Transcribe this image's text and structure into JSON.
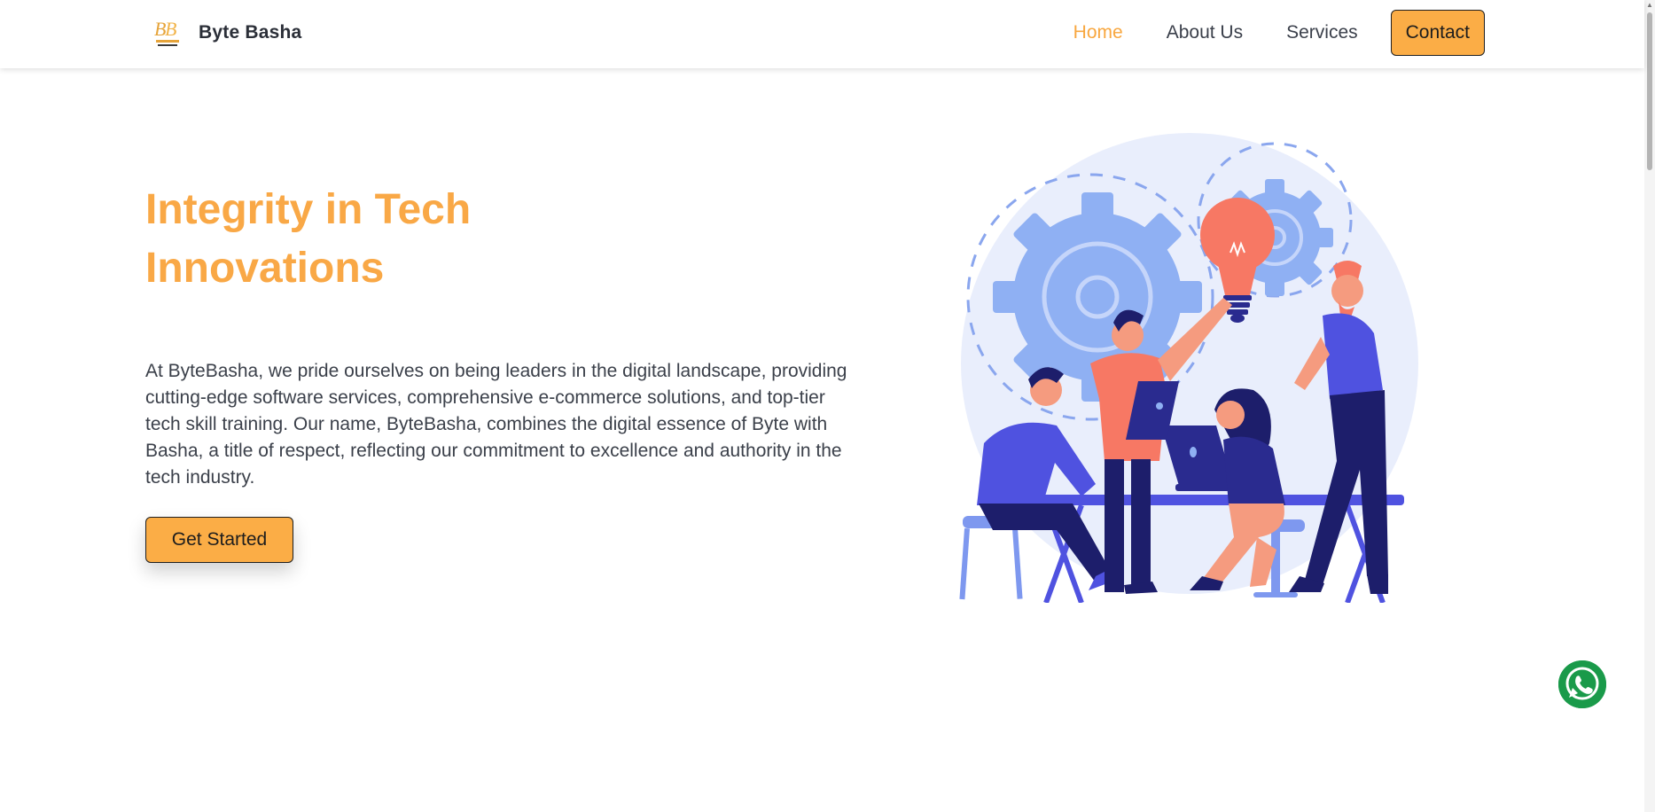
{
  "brand": {
    "name": "Byte Basha",
    "logo_icon": "bytebasha-logo-icon"
  },
  "nav": {
    "items": [
      {
        "label": "Home",
        "active": true
      },
      {
        "label": "About Us",
        "active": false
      },
      {
        "label": "Services",
        "active": false
      }
    ],
    "contact_label": "Contact"
  },
  "hero": {
    "title_line1": "Integrity in Tech",
    "title_line2": "Innovations",
    "description": "At ByteBasha, we pride ourselves on being leaders in the digital landscape, providing cutting-edge software services, comprehensive e-commerce solutions, and top-tier tech skill training. Our name, ByteBasha, combines the digital essence of Byte with Basha, a title of respect, reflecting our commitment to excellence and authority in the tech industry.",
    "cta_label": "Get Started",
    "illustration": "team-collaboration-illustration"
  },
  "floating": {
    "whatsapp_icon": "whatsapp-icon"
  },
  "colors": {
    "accent": "#f9a846",
    "button": "#fbad46",
    "whatsapp": "#1a9a4a",
    "illustration_blue": "#4f52e0"
  }
}
